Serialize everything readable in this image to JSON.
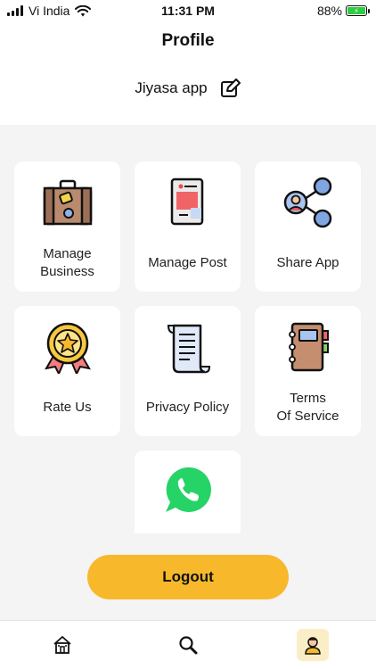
{
  "status_bar": {
    "carrier": "Vi India",
    "time": "11:31 PM",
    "battery": "88%"
  },
  "header": {
    "title": "Profile"
  },
  "business": {
    "name": "Jiyasa app",
    "edit_icon": "edit-icon"
  },
  "tiles": [
    {
      "label_line1": "Manage",
      "label_line2": "Business",
      "icon": "briefcase-icon"
    },
    {
      "label_line1": "Manage Post",
      "label_line2": "",
      "icon": "tablet-post-icon"
    },
    {
      "label_line1": "Share App",
      "label_line2": "",
      "icon": "share-icon"
    },
    {
      "label_line1": "Rate Us",
      "label_line2": "",
      "icon": "star-badge-icon"
    },
    {
      "label_line1": "Privacy Policy",
      "label_line2": "",
      "icon": "document-scroll-icon"
    },
    {
      "label_line1": "Terms",
      "label_line2": "Of Service",
      "icon": "notebook-icon"
    },
    {
      "label_line1": "",
      "label_line2": "",
      "icon": "whatsapp-icon"
    }
  ],
  "logout": {
    "label": "Logout"
  },
  "nav": {
    "items": [
      {
        "icon": "home-icon",
        "active": false
      },
      {
        "icon": "search-icon",
        "active": false
      },
      {
        "icon": "profile-icon",
        "active": true
      }
    ]
  },
  "colors": {
    "accent": "#f7b92b",
    "background": "#f4f4f5",
    "active_nav_bg": "#fbeec7",
    "whatsapp_green": "#25d366"
  }
}
